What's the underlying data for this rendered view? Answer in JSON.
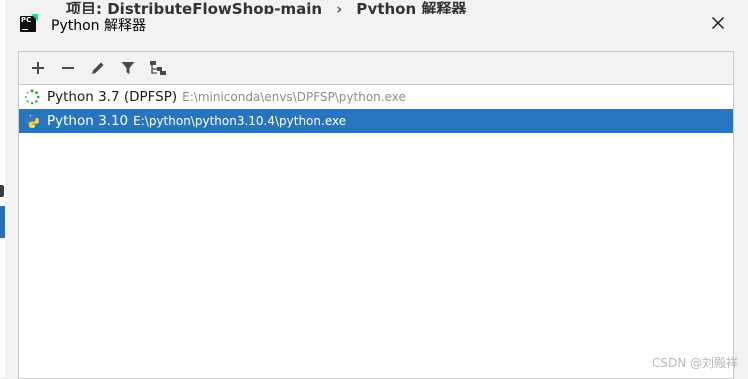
{
  "background": {
    "breadcrumb_project": "项目: DistributeFlowShop-main",
    "breadcrumb_separator": "›",
    "breadcrumb_page": "Python 解释器"
  },
  "dialog": {
    "title": "Python 解释器",
    "close_icon": "close-icon"
  },
  "toolbar": {
    "buttons": [
      {
        "icon": "add-icon"
      },
      {
        "icon": "remove-icon"
      },
      {
        "icon": "edit-icon"
      },
      {
        "icon": "filter-icon"
      },
      {
        "icon": "tree-icon"
      }
    ]
  },
  "interpreters": [
    {
      "name": "Python 3.7 (DPFSP)",
      "path": "E:\\miniconda\\envs\\DPFSP\\python.exe",
      "icon": "loading-spinner-icon",
      "selected": false
    },
    {
      "name": "Python 3.10",
      "path": "E:\\python\\python3.10.4\\python.exe",
      "icon": "python-logo-icon",
      "selected": true
    }
  ],
  "colors": {
    "selection": "#2675bf",
    "path_text": "#8c8c8c",
    "spinner": "#3fae49"
  },
  "watermark": "CSDN @刘殿祥"
}
